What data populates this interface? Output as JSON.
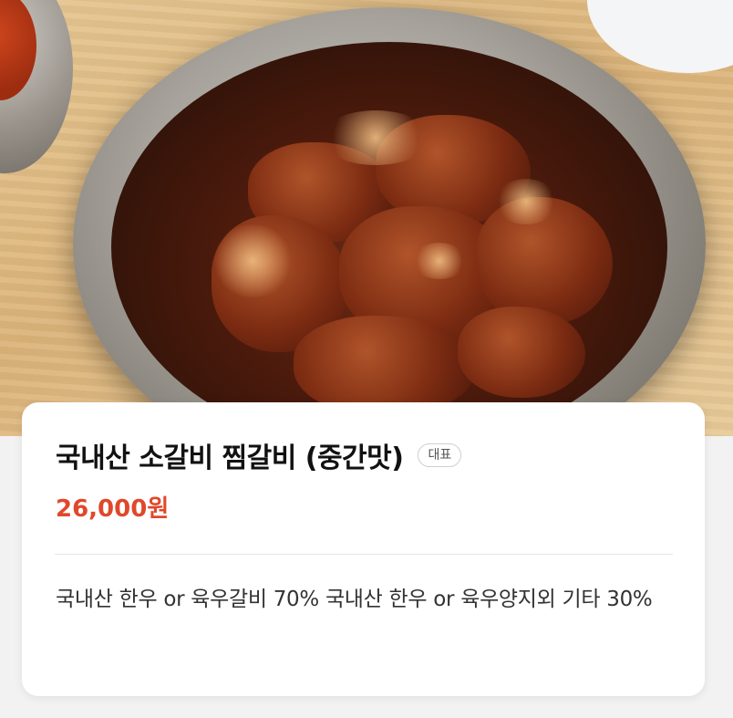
{
  "menu_item": {
    "name": "국내산 소갈비 찜갈비 (중간맛)",
    "badge": "대표",
    "price": "26,000원",
    "description": "국내산 한우 or 육우갈비 70% 국내산 한우 or 육우양지외 기타 30%"
  },
  "colors": {
    "price": "#e0482b",
    "title": "#111111",
    "card_background": "#ffffff",
    "page_background": "#f2f2f2"
  }
}
